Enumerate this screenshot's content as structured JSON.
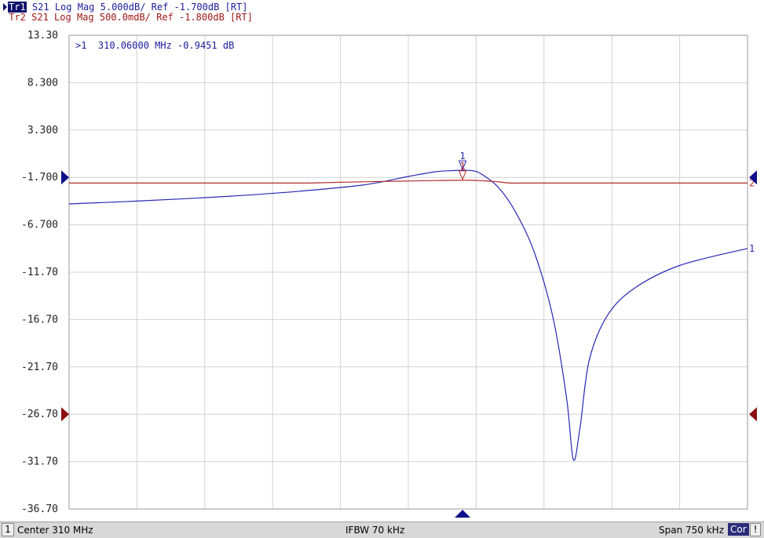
{
  "traces": [
    {
      "id": "Tr1",
      "text": "S21 Log Mag 5.000dB/ Ref -1.700dB [RT]",
      "color": "#1c1c9c"
    },
    {
      "id": "Tr2",
      "text": "S21 Log Mag 500.0mdB/ Ref -1.800dB [RT]",
      "color": "#a01818"
    }
  ],
  "marker_readout": ">1  310.06000 MHz -0.9451 dB",
  "chart_data": {
    "type": "line",
    "xlabel": "",
    "ylabel": "",
    "xlim": [
      309.625,
      310.375
    ],
    "ylim": [
      -36.7,
      13.3
    ],
    "y_ticks": [
      "13.30",
      "8.300",
      "3.300",
      "-1.700",
      "-6.700",
      "-11.70",
      "-16.70",
      "-21.70",
      "-26.70",
      "-31.70",
      "-36.70"
    ],
    "grid": true,
    "series": [
      {
        "color": "#2828b4",
        "x": [
          309.625,
          309.7,
          309.8,
          309.875,
          309.95,
          310.0,
          310.03,
          310.05,
          310.06,
          310.07,
          310.08,
          310.1,
          310.12,
          310.14,
          310.16,
          310.175,
          310.1825,
          310.19,
          310.2,
          310.22,
          310.25,
          310.3,
          310.375
        ],
        "y": [
          -4.5,
          -4.2,
          -3.7,
          -3.2,
          -2.5,
          -1.6,
          -1.1,
          -0.98,
          -0.945,
          -0.99,
          -1.3,
          -2.8,
          -5.6,
          -9.8,
          -16.5,
          -25.0,
          -31.5,
          -28.0,
          -21.0,
          -16.3,
          -13.4,
          -11.0,
          -9.2
        ],
        "end_label": "1"
      },
      {
        "color": "#b42828",
        "x": [
          309.625,
          309.65,
          309.7,
          309.75,
          309.8,
          309.85,
          309.885,
          309.9,
          309.95,
          310.0,
          310.03,
          310.05,
          310.06,
          310.07,
          310.08,
          310.09,
          310.1,
          310.1125,
          310.125,
          310.2,
          310.375
        ],
        "y": [
          -2.3,
          -2.3,
          -2.3,
          -2.3,
          -2.3,
          -2.3,
          -2.3,
          -2.27,
          -2.16,
          -2.08,
          -2.03,
          -2.008,
          -2.0,
          -2.01,
          -2.04,
          -2.1,
          -2.17,
          -2.3,
          -2.3,
          -2.3,
          -2.3
        ],
        "end_label": "2"
      }
    ],
    "marker": {
      "label": "1",
      "x": 310.06
    }
  },
  "status": {
    "channel": "1",
    "center": "Center 310 MHz",
    "ifbw": "IFBW 70 kHz",
    "span": "Span 750 kHz",
    "cor": "Cor",
    "warn": "!"
  }
}
